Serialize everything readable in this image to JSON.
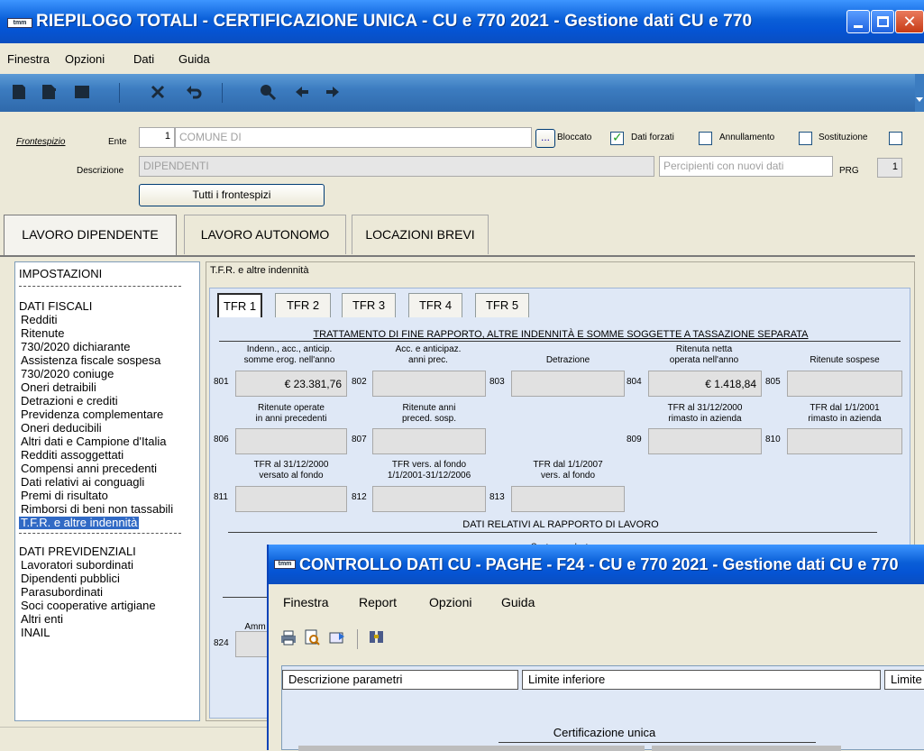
{
  "main_window": {
    "title": "RIEPILOGO TOTALI - CERTIFICAZIONE UNICA - CU e 770 2021 - Gestione dati CU e 770",
    "app_icon": "tmm"
  },
  "menu": [
    "Finestra",
    "Opzioni",
    "Dati",
    "Guida"
  ],
  "header": {
    "frontespizio_link": "Frontespizio",
    "ente_label": "Ente",
    "ente_num": "1",
    "ente_name": "COMUNE DI",
    "lookup_btn": "...",
    "bloccato_label": "Bloccato",
    "bloccato": true,
    "dati_forzati_label": "Dati forzati",
    "annullamento_label": "Annullamento",
    "sostituzione_label": "Sostituzione",
    "descrizione_label": "Descrizione",
    "descrizione_value": "DIPENDENTI",
    "percipienti_placeholder": "Percipienti con nuovi dati",
    "prg_label": "PRG",
    "prg_value": "1",
    "tutti_btn": "Tutti i frontespizi"
  },
  "section_tabs": [
    "LAVORO DIPENDENTE",
    "LAVORO AUTONOMO",
    "LOCAZIONI BREVI"
  ],
  "tree": {
    "impostazioni": "IMPOSTAZIONI",
    "dati_fiscali": "DATI FISCALI",
    "fiscali_items": [
      "Redditi",
      "Ritenute",
      "730/2020 dichiarante",
      "Assistenza fiscale sospesa",
      "730/2020 coniuge",
      "Oneri detraibili",
      "Detrazioni e crediti",
      "Previdenza complementare",
      "Oneri deducibili",
      "Altri dati e Campione d'Italia",
      "Redditi assoggettati",
      "Compensi anni precedenti",
      "Dati relativi ai conguagli",
      "Premi di risultato",
      "Rimborsi di beni non tassabili"
    ],
    "selected": "T.F.R. e altre indennità",
    "dati_previdenziali": "DATI PREVIDENZIALI",
    "previdenziali_items": [
      "Lavoratori subordinati",
      "Dipendenti pubblici",
      "Parasubordinati",
      "Soci cooperative artigiane",
      "Altri enti",
      "INAIL"
    ]
  },
  "panel": {
    "title": "T.F.R. e altre indennità",
    "tfr_tabs": [
      "TFR 1",
      "TFR 2",
      "TFR 3",
      "TFR 4",
      "TFR 5"
    ],
    "section_title": "TRATTAMENTO DI FINE RAPPORTO, ALTRE INDENNITÀ E SOMME SOGGETTE A TASSAZIONE SEPARATA",
    "fields": {
      "f801": {
        "num": "801",
        "cap1": "Indenn., acc., anticip.",
        "cap2": "somme erog. nell'anno",
        "value": "€ 23.381,76"
      },
      "f802": {
        "num": "802",
        "cap1": "Acc. e anticipaz.",
        "cap2": "anni prec.",
        "value": ""
      },
      "f803": {
        "num": "803",
        "cap1": "",
        "cap2": "Detrazione",
        "value": ""
      },
      "f804": {
        "num": "804",
        "cap1": "Ritenuta netta",
        "cap2": "operata nell'anno",
        "value": "€ 1.418,84"
      },
      "f805": {
        "num": "805",
        "cap1": "",
        "cap2": "Ritenute sospese",
        "value": ""
      },
      "f806": {
        "num": "806",
        "cap1": "Ritenute operate",
        "cap2": "in anni precedenti",
        "value": ""
      },
      "f807": {
        "num": "807",
        "cap1": "Ritenute anni",
        "cap2": "preced. sosp.",
        "value": ""
      },
      "f809": {
        "num": "809",
        "cap1": "TFR al 31/12/2000",
        "cap2": "rimasto in azienda",
        "value": ""
      },
      "f810": {
        "num": "810",
        "cap1": "TFR dal 1/1/2001",
        "cap2": "rimasto in azienda",
        "value": ""
      },
      "f811": {
        "num": "811",
        "cap1": "TFR al 31/12/2000",
        "cap2": "versato al fondo",
        "value": ""
      },
      "f812": {
        "num": "812",
        "cap1": "TFR vers. al fondo",
        "cap2": "1/1/2001-31/12/2006",
        "value": ""
      },
      "f813": {
        "num": "813",
        "cap1": "TFR dal 1/1/2007",
        "cap2": "vers. al fondo",
        "value": ""
      }
    },
    "rapporto_title": "DATI RELATIVI AL RAPPORTO DI LAVORO",
    "quota_partial": "Quota eccedente",
    "amm_partial": "Amm",
    "f824_num": "824"
  },
  "win2": {
    "title": "CONTROLLO DATI CU - PAGHE - F24 - CU e 770 2021 - Gestione dati CU e 770",
    "app_icon": "tmm",
    "menu": [
      "Finestra",
      "Report",
      "Opzioni",
      "Guida"
    ],
    "columns": [
      "Descrizione parametri",
      "Limite inferiore",
      "Limite superiore"
    ],
    "group": "Certificazione unica"
  }
}
